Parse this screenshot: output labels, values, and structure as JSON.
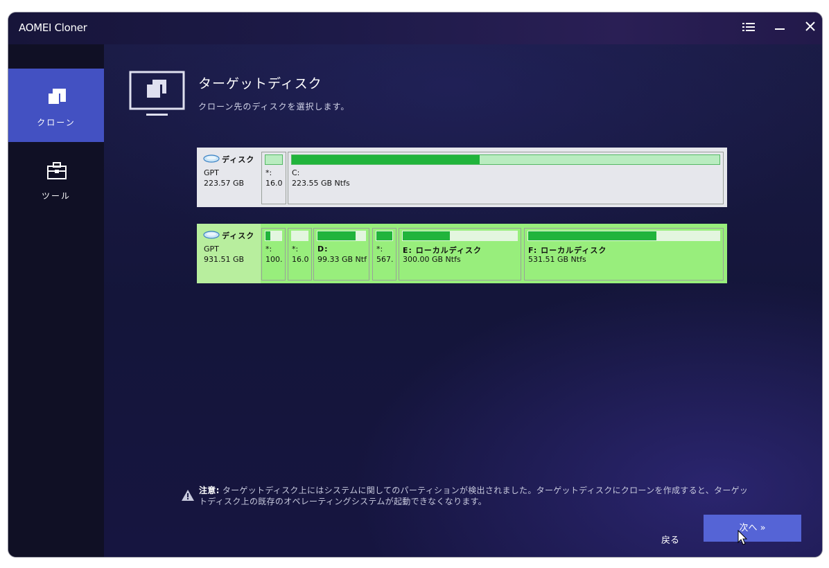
{
  "window": {
    "title": "AOMEI Cloner"
  },
  "titlebar": {
    "menu_icon": "menu-list-icon",
    "minimize_icon": "minimize-icon",
    "close_icon": "close-icon"
  },
  "sidebar": {
    "items": [
      {
        "label": "クローン",
        "icon": "clone-icon",
        "active": true
      },
      {
        "label": "ツール",
        "icon": "toolbox-icon",
        "active": false
      }
    ]
  },
  "header": {
    "title": "ターゲットディスク",
    "subtitle": "クローン先のディスクを選択します。",
    "icon": "monitor-clone-icon"
  },
  "disks": [
    {
      "name": "ディスク",
      "type": "GPT",
      "size": "223.57 GB",
      "selected": false,
      "partitions": [
        {
          "label": "*:",
          "size": "16.0",
          "used_fraction": 0.0
        },
        {
          "label": "C:",
          "size": "223.55 GB Ntfs",
          "used_fraction": 0.44
        }
      ]
    },
    {
      "name": "ディスク",
      "type": "GPT",
      "size": "931.51 GB",
      "selected": true,
      "partitions": [
        {
          "label": "*:",
          "size": "100.",
          "used_fraction": 0.3
        },
        {
          "label": "*:",
          "size": "16.0",
          "used_fraction": 0.0
        },
        {
          "label": "D:",
          "size": "99.33 GB Ntf",
          "used_fraction": 0.8
        },
        {
          "label": "*:",
          "size": "567.",
          "used_fraction": 1.0
        },
        {
          "label": "E: ローカルディスク",
          "size": "300.00 GB Ntfs",
          "used_fraction": 0.41
        },
        {
          "label": "F: ローカルディスク",
          "size": "531.51 GB Ntfs",
          "used_fraction": 0.67
        }
      ]
    }
  ],
  "warning": {
    "icon": "warning-triangle-icon",
    "label": "注意:",
    "text": " ターゲットディスク上にはシステムに関してのパーティションが検出されました。ターゲットディスクにクローンを作成すると、ターゲットディスク上の既存のオペレーティングシステムが起動できなくなります。"
  },
  "footer": {
    "back_label": "戻る",
    "next_label": "次へ »"
  },
  "colors": {
    "accent": "#4351c2",
    "button": "#5564d6",
    "partition_used": "#21b43c",
    "selected_disk": "#98ee7c"
  }
}
